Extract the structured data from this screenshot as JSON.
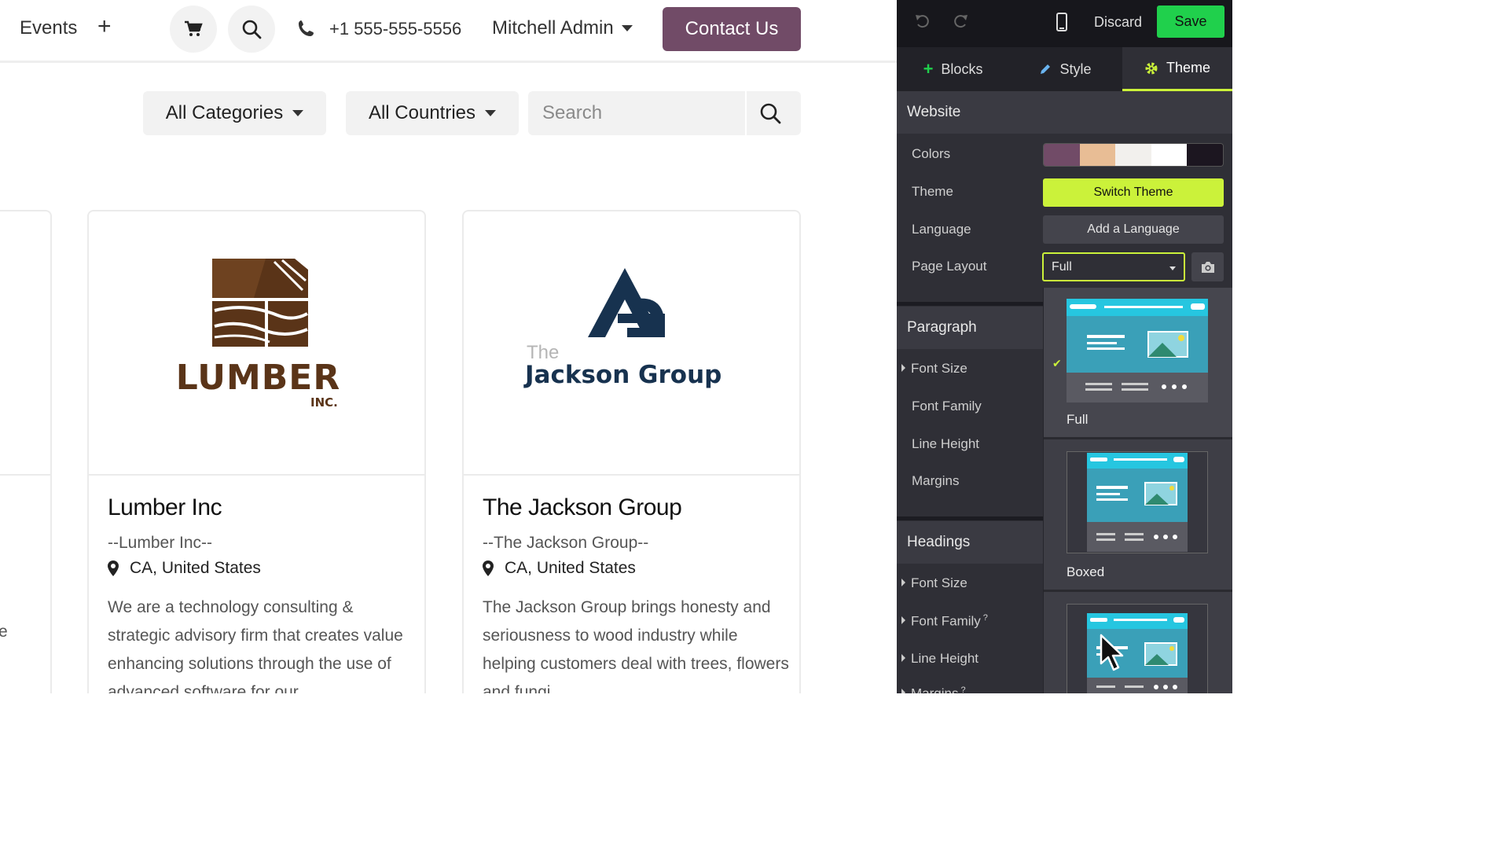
{
  "site": {
    "nav": {
      "events": "Events",
      "add": "+",
      "phone": "+1 555-555-5556",
      "user": "Mitchell Admin",
      "contact": "Contact Us"
    },
    "filters": {
      "categories": "All Categories",
      "countries": "All Countries",
      "search_placeholder": "Search"
    },
    "cards": [
      {
        "logo_word": "LUMBER",
        "logo_sub": "INC.",
        "title": "Lumber Inc",
        "subtitle": "--Lumber Inc--",
        "location": "CA, United States",
        "description": "We are a technology consulting & strategic advisory firm that creates value enhancing solutions through the use of advanced software for our"
      },
      {
        "logo_the": "The",
        "logo_word": "Jackson Group",
        "title": "The Jackson Group",
        "subtitle": "--The Jackson Group--",
        "location": "CA, United States",
        "description": "The Jackson Group brings honesty and seriousness to wood industry while helping customers deal with trees, flowers and fungi."
      }
    ],
    "left_edge_char": "e"
  },
  "editor": {
    "toolbar": {
      "discard": "Discard",
      "save": "Save"
    },
    "tabs": [
      {
        "label": "Blocks",
        "icon": "plus-icon"
      },
      {
        "label": "Style",
        "icon": "pencil-icon"
      },
      {
        "label": "Theme",
        "icon": "gear-icon",
        "active": true
      }
    ],
    "website": {
      "header": "Website",
      "colors_label": "Colors",
      "palette": [
        "#714b67",
        "#e8bd95",
        "#f2f0ed",
        "#ffffff",
        "#1c1620"
      ],
      "theme_label": "Theme",
      "switch_theme": "Switch Theme",
      "language_label": "Language",
      "add_language": "Add a Language",
      "page_layout_label": "Page Layout",
      "page_layout_value": "Full"
    },
    "paragraph": {
      "header": "Paragraph",
      "font_size": "Font Size",
      "font_family": "Font Family",
      "line_height": "Line Height",
      "margins": "Margins"
    },
    "headings": {
      "header": "Headings",
      "font_size": "Font Size",
      "font_family": "Font Family",
      "font_family_sup": "?",
      "line_height": "Line Height",
      "margins": "Margins",
      "margins_sup": "?"
    },
    "layout_options": [
      {
        "label": "Full",
        "selected": true
      },
      {
        "label": "Boxed",
        "selected": false
      }
    ],
    "check": "✔",
    "accent": "#cbf23a",
    "save_color": "#20d04c",
    "brand": "#714b67"
  }
}
